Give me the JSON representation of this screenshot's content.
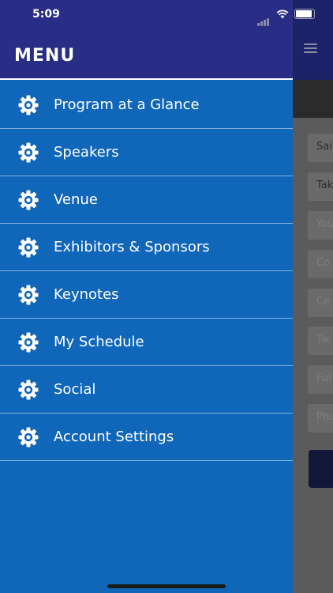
{
  "status_bar": {
    "time": "5:09"
  },
  "menu": {
    "title": "MENU",
    "items": [
      {
        "label": "Program at a Glance",
        "icon": "gear-icon"
      },
      {
        "label": "Speakers",
        "icon": "gear-icon"
      },
      {
        "label": "Venue",
        "icon": "gear-icon"
      },
      {
        "label": "Exhibitors & Sponsors",
        "icon": "gear-icon"
      },
      {
        "label": "Keynotes",
        "icon": "gear-icon"
      },
      {
        "label": "My Schedule",
        "icon": "gear-icon"
      },
      {
        "label": "Social",
        "icon": "gear-icon"
      },
      {
        "label": "Account Settings",
        "icon": "gear-icon"
      }
    ]
  },
  "background_form": {
    "fields": [
      "Sai",
      "Tak",
      "You",
      "Co",
      "Ce",
      "Tw",
      "Ful",
      "Pho"
    ]
  },
  "colors": {
    "drawer_bg": "#1066b9",
    "header_bg": "#2a2d86",
    "divider": "#7fb0de"
  }
}
